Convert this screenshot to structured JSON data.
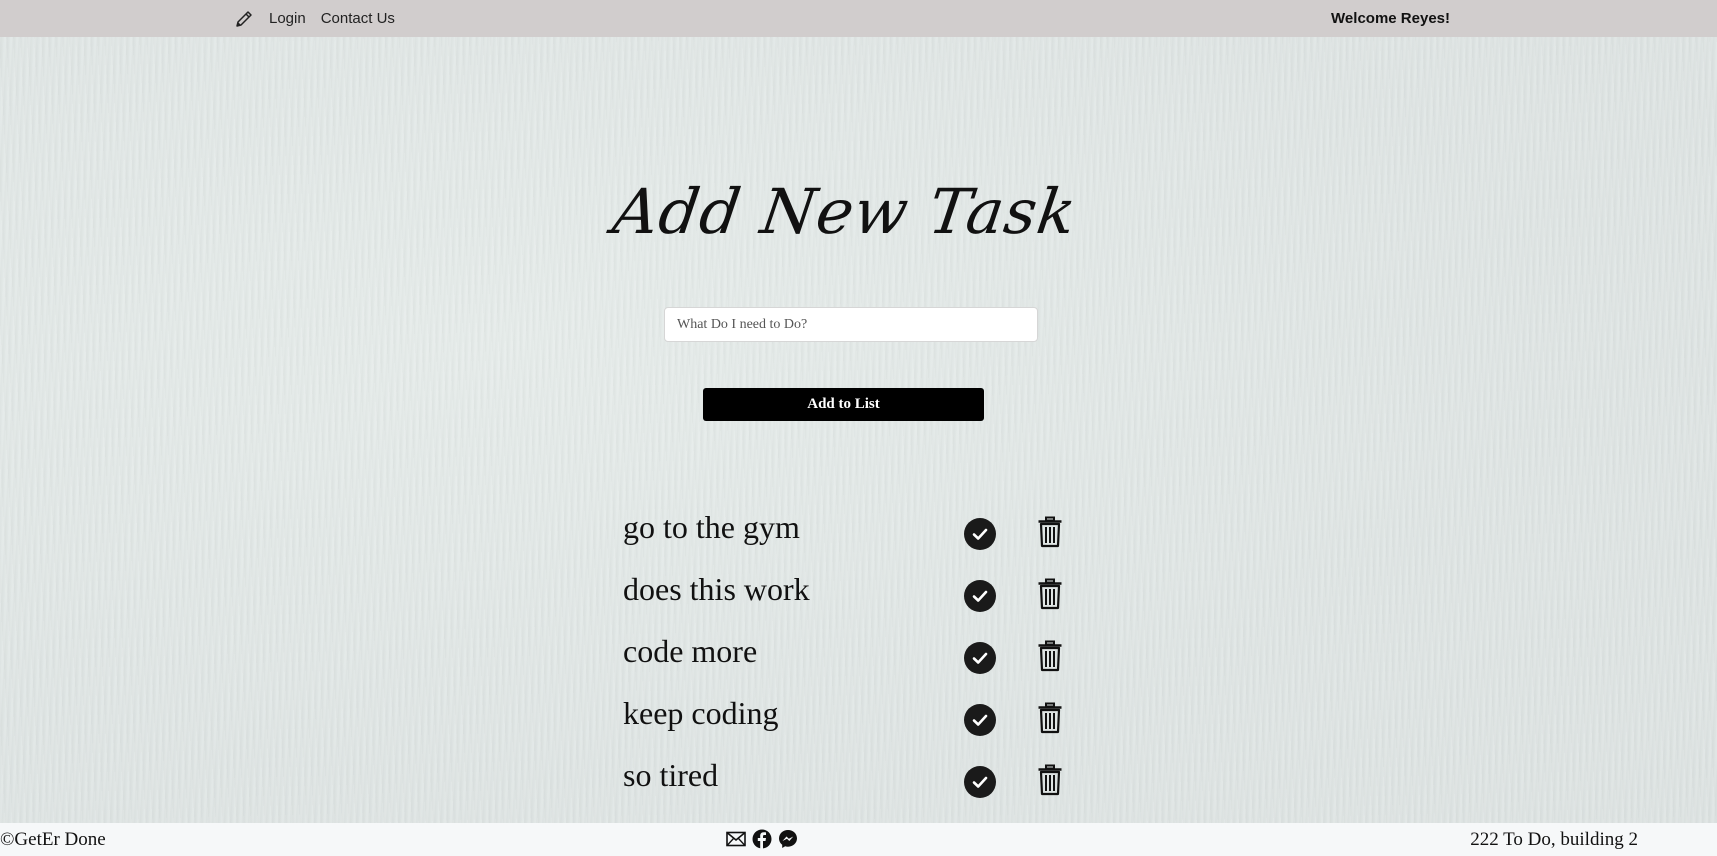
{
  "navbar": {
    "logo_icon": "pencil-icon",
    "links": [
      "Login",
      "Contact Us"
    ],
    "welcome": "Welcome Reyes!"
  },
  "main": {
    "title": "Add New Task",
    "input_placeholder": "What Do I need to Do?",
    "input_value": "",
    "add_button_label": "Add to List"
  },
  "tasks": [
    {
      "text": "go to the gym"
    },
    {
      "text": "does this work"
    },
    {
      "text": "code more"
    },
    {
      "text": "keep coding"
    },
    {
      "text": "so tired"
    }
  ],
  "footer": {
    "copyright": "©GetEr Done",
    "icons": [
      "email-icon",
      "facebook-icon",
      "messenger-icon"
    ],
    "address": "222 To Do, building 2"
  }
}
